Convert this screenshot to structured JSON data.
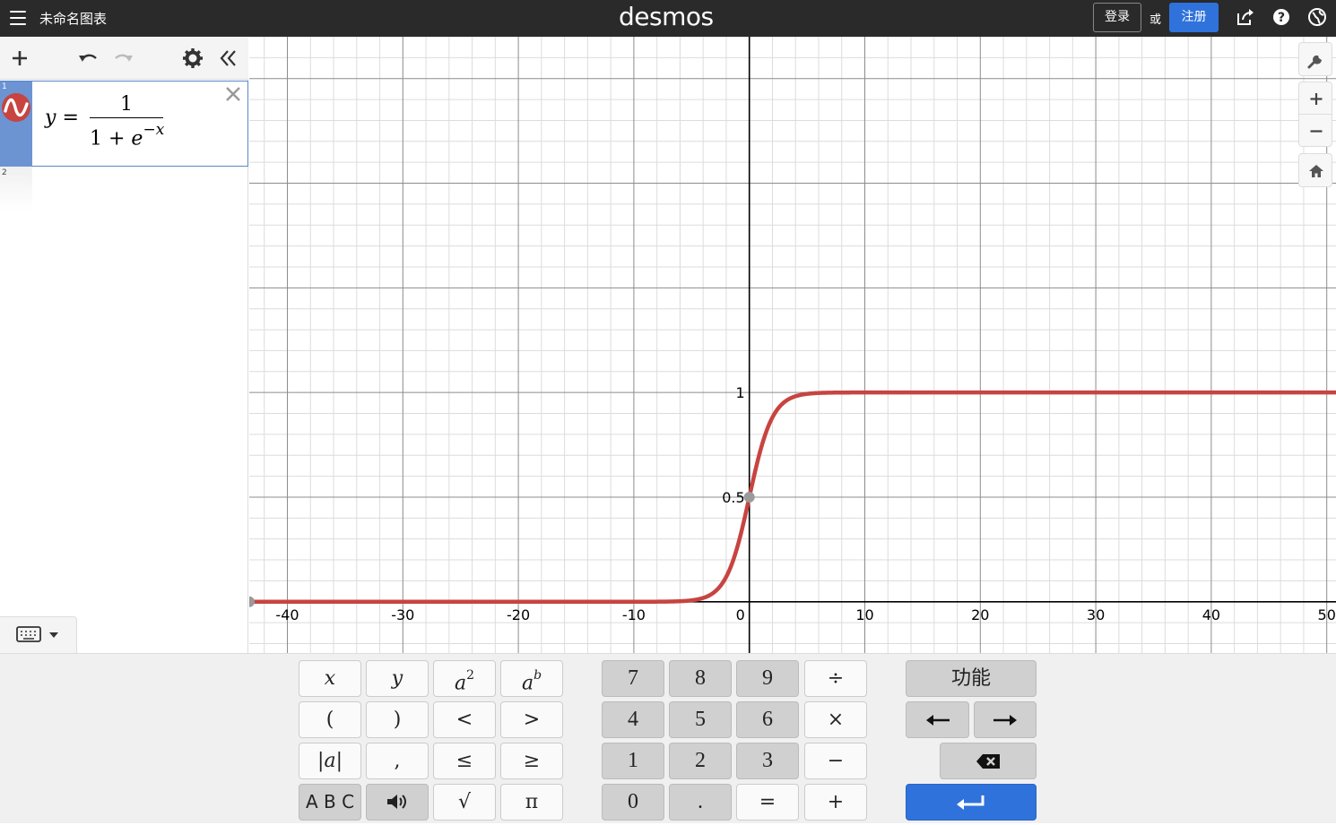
{
  "header": {
    "graph_title": "未命名图表",
    "logo": "desmos",
    "login_label": "登录",
    "or_label": "或",
    "signup_label": "注册"
  },
  "expressions": [
    {
      "index": "1",
      "lhs": "y =",
      "numerator": "1",
      "denominator_base": "1 + e",
      "denominator_exponent": "−x",
      "color": "#c74440"
    },
    {
      "index": "2"
    }
  ],
  "graph": {
    "x_ticks": [
      "-40",
      "-30",
      "-20",
      "-10",
      "0",
      "10",
      "20",
      "30",
      "40",
      "50"
    ],
    "y_ticks": [
      "0.5",
      "1"
    ],
    "curve_color": "#c74440"
  },
  "chart_data": {
    "type": "line",
    "title": "",
    "xlabel": "",
    "ylabel": "",
    "xlim": [
      -43.3,
      50.8
    ],
    "ylim": [
      -0.245,
      2.7
    ],
    "grid": true,
    "series": [
      {
        "function": "1/(1+exp(-x))",
        "color": "#c74440"
      }
    ],
    "points": [
      {
        "x": 0,
        "y": 0.5
      },
      {
        "x": -43.3,
        "y": 0
      }
    ]
  },
  "keypad": {
    "left": [
      "x",
      "y",
      "a2",
      "ab",
      "(",
      ")",
      "<",
      ">",
      "|a|",
      ",",
      "≤",
      "≥",
      "A B C",
      "speaker",
      "√",
      "π"
    ],
    "middle": [
      "7",
      "8",
      "9",
      "÷",
      "4",
      "5",
      "6",
      "×",
      "1",
      "2",
      "3",
      "−",
      "0",
      ".",
      "=",
      "+"
    ],
    "functions_label": "功能"
  }
}
